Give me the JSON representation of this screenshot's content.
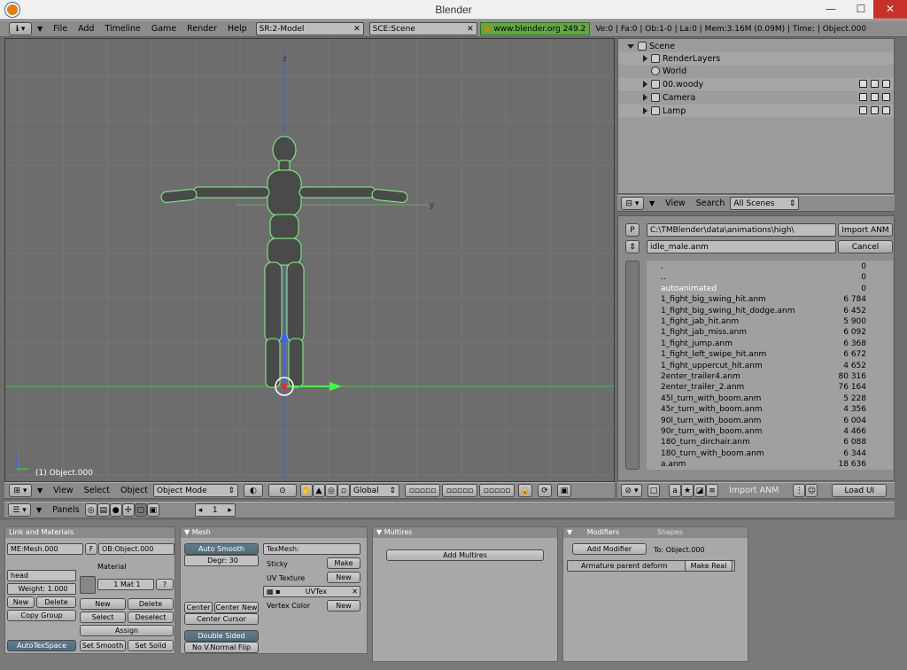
{
  "window": {
    "title": "Blender",
    "minimize": "—",
    "maximize": "☐",
    "close": "✕"
  },
  "top_header": {
    "menus": [
      "File",
      "Add",
      "Timeline",
      "Game",
      "Render",
      "Help"
    ],
    "screen": "SR:2-Model",
    "scene": "SCE:Scene",
    "website": "www.blender.org 249.2",
    "stats": "Ve:0 | Fa:0 | Ob:1-0 | La:0  | Mem:3.16M (0.09M) | Time: | Object.000"
  },
  "viewport": {
    "axis_z": "z",
    "axis_y": "y",
    "object_label": "(1) Object.000"
  },
  "viewport_header": {
    "menus": [
      "View",
      "Select",
      "Object"
    ],
    "mode": "Object Mode",
    "orientation": "Global"
  },
  "outliner": {
    "rows": [
      {
        "label": "Scene",
        "indent": 0,
        "expanded": true
      },
      {
        "label": "RenderLayers",
        "indent": 1,
        "expanded": false
      },
      {
        "label": "World",
        "indent": 1,
        "expanded": null
      },
      {
        "label": "00.woody",
        "indent": 1,
        "expanded": false
      },
      {
        "label": "Camera",
        "indent": 1,
        "expanded": false
      },
      {
        "label": "Lamp",
        "indent": 1,
        "expanded": false
      }
    ],
    "header_menus": [
      "View",
      "Search"
    ],
    "scenes_dropdown": "All Scenes"
  },
  "file_browser": {
    "p_button": "P",
    "path": "C:\\TMBlender\\data\\animations\\high\\",
    "filename": "idle_male.anm",
    "import_button": "Import ANM",
    "cancel_button": "Cancel",
    "files": [
      {
        "name": ".",
        "size": "0"
      },
      {
        "name": "..",
        "size": "0"
      },
      {
        "name": "autoanimated",
        "size": "0"
      },
      {
        "name": "1_fight_big_swing_hit.anm",
        "size": "6 784"
      },
      {
        "name": "1_fight_big_swing_hit_dodge.anm",
        "size": "6 452"
      },
      {
        "name": "1_fight_jab_hit.anm",
        "size": "5 900"
      },
      {
        "name": "1_fight_jab_miss.anm",
        "size": "6 092"
      },
      {
        "name": "1_fight_jump.anm",
        "size": "6 368"
      },
      {
        "name": "1_fight_left_swipe_hit.anm",
        "size": "6 672"
      },
      {
        "name": "1_fight_uppercut_hit.anm",
        "size": "4 652"
      },
      {
        "name": "2enter_trailer4.anm",
        "size": "80 316"
      },
      {
        "name": "2enter_trailer_2.anm",
        "size": "76 164"
      },
      {
        "name": "45l_turn_with_boom.anm",
        "size": "5 228"
      },
      {
        "name": "45r_turn_with_boom.anm",
        "size": "4 356"
      },
      {
        "name": "90l_turn_with_boom.anm",
        "size": "6 004"
      },
      {
        "name": "90r_turn_with_boom.anm",
        "size": "4 466"
      },
      {
        "name": "180_turn_dirchair.anm",
        "size": "6 088"
      },
      {
        "name": "180_turn_with_boom.anm",
        "size": "6 344"
      },
      {
        "name": "a.anm",
        "size": "18 636"
      }
    ],
    "footer_label": "Import ANM",
    "load_ui": "Load UI"
  },
  "buttons_header": {
    "panels_label": "Panels",
    "frame": "1"
  },
  "panels": {
    "link_materials": {
      "title": "Link and Materials",
      "mesh_field": "ME:Mesh.000",
      "f_label": "F",
      "ob_field": "OB:Object.000",
      "material_label": "Material",
      "group_field": "head",
      "weight_field": "Weight: 1.000",
      "new": "New",
      "delete": "Delete",
      "copy_group": "Copy Group",
      "mat_field": "1 Mat 1",
      "q": "?",
      "mat_new": "New",
      "mat_delete": "Delete",
      "select": "Select",
      "deselect": "Deselect",
      "assign": "Assign",
      "autotexspace": "AutoTexSpace",
      "set_smooth": "Set Smooth",
      "set_solid": "Set Solid"
    },
    "mesh": {
      "title": "Mesh",
      "auto_smooth": "Auto Smooth",
      "degr": "Degr: 30",
      "texmesh": "TexMesh:",
      "sticky": "Sticky",
      "make": "Make",
      "uv_texture": "UV Texture",
      "uv_new": "New",
      "uvtex": "UVTex",
      "vertex_color": "Vertex Color",
      "vc_new": "New",
      "center": "Center",
      "center_new": "Center New",
      "center_cursor": "Center Cursor",
      "double_sided": "Double Sided",
      "no_vnormal_flip": "No V.Normal Flip"
    },
    "multires": {
      "title": "Multires",
      "add_multires": "Add Multires"
    },
    "modifiers": {
      "tab_modifiers": "Modifiers",
      "tab_shapes": "Shapes",
      "add_modifier": "Add Modifier",
      "to_object": "To: Object.000",
      "armature_label": "Armature parent deform",
      "make_real": "Make Real"
    }
  },
  "colors": {
    "viewport_bg": "#6d6d6d",
    "grid": "#7a7a7a",
    "axis_green": "#3fbf3f",
    "axis_blue": "#3f5fbf",
    "model": "#4a4a4a",
    "model_outline": "#7dff7d",
    "accent_green": "#5ea840",
    "button_dark": "#5e7d8e"
  }
}
